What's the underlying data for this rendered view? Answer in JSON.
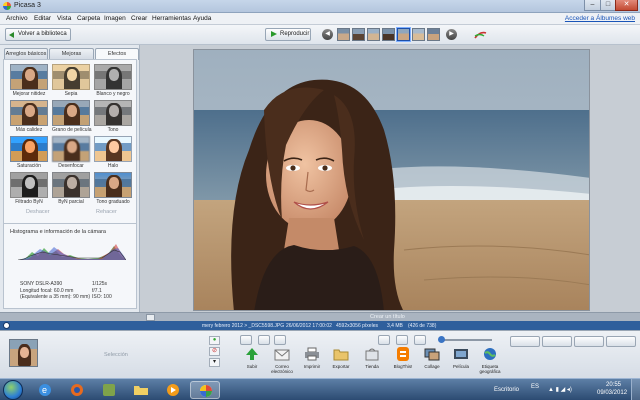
{
  "window": {
    "title": "Picasa 3",
    "minimize": "–",
    "maximize": "□",
    "close": "✕"
  },
  "menu": {
    "items": [
      "Archivo",
      "Editar",
      "Vista",
      "Carpeta",
      "Imagen",
      "Crear",
      "Herramientas",
      "Ayuda"
    ],
    "account_link": "Acceder a Álbumes web"
  },
  "toolbar": {
    "back_label": "Volver a biblioteca",
    "play_label": "Reproducir"
  },
  "left_panel": {
    "tabs": [
      "Arreglos básicos",
      "Mejoras",
      "Efectos"
    ],
    "active_tab": "Efectos",
    "effects": [
      "Mejorar nitidez",
      "Sepia",
      "Blanco y negro",
      "Más calidez",
      "Grano de película",
      "Tono",
      "Saturación",
      "Desenfocar",
      "Halo",
      "Filtrado ByN",
      "ByN parcial",
      "Tono graduado"
    ],
    "undo_label": "Deshacer",
    "redo_label": "Rehacer",
    "histogram_title": "Histograma e información de la cámara",
    "camera_left": [
      "SONY DSLR-A390",
      "Longitud focal: 60.0 mm",
      "(Equivalente a 35 mm): 90 mm)"
    ],
    "camera_right": [
      "1/125s",
      "f/7.1",
      "ISO: 100"
    ]
  },
  "viewer": {
    "caption_placeholder": "Crear un título"
  },
  "info_bar": {
    "path": "mery febrero 2012 > _DSC5598.JPG",
    "datetime": "26/06/2012 17:00:02",
    "dimensions": "4592x3056 píxeles",
    "size": "3,4 MB",
    "position": "(426 de 738)"
  },
  "bottom": {
    "selection_label": "Selección",
    "actions": [
      "Subir",
      "Correo electrónico",
      "Imprimir",
      "Exportar",
      "Tienda",
      "BlogThis!",
      "Collage",
      "Película",
      "Etiqueta geográfica"
    ]
  },
  "taskbar": {
    "location": "Escritorio",
    "language": "ES",
    "time": "20:55",
    "date": "09/03/2012"
  },
  "colors": {
    "accent": "#2f5f9c",
    "link": "#1a55b8",
    "title_bar": "#c6d6ea"
  }
}
